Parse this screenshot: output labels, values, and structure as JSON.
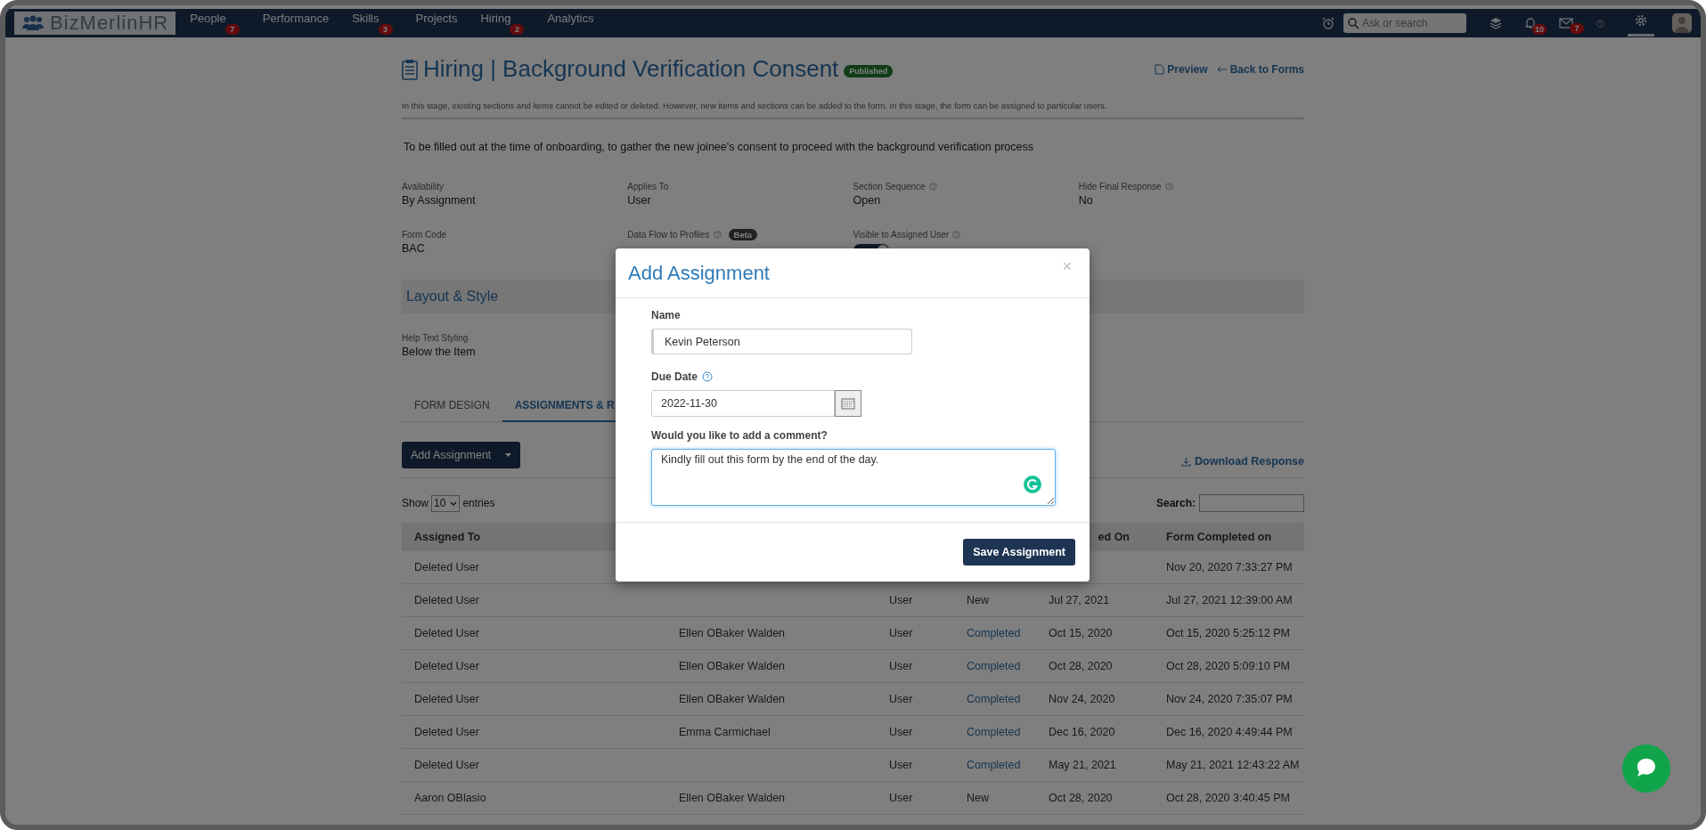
{
  "nav": {
    "logo": "BizMerlinHR",
    "items": [
      {
        "label": "People",
        "badge": "7"
      },
      {
        "label": "Performance"
      },
      {
        "label": "Skills",
        "badge": "3"
      },
      {
        "label": "Projects"
      },
      {
        "label": "Hiring",
        "badge": "2"
      },
      {
        "label": "Analytics"
      }
    ],
    "search": {
      "placeholder": "Ask or search"
    },
    "notifications_badge": "10",
    "messages_badge": "7"
  },
  "page": {
    "title": "Hiring | Background Verification Consent",
    "status": "Published",
    "links": [
      "Preview",
      "Back to Forms"
    ],
    "stage_note": "In this stage, existing sections and items cannot be edited or deleted. However, new items and sections can be added to the form. In this stage, the form can be assigned to particular users.",
    "description": "To be filled out at the time of onboarding, to gather the new joinee's consent to proceed with the background verification process",
    "details": [
      {
        "kind": "text",
        "label": "Availability",
        "value": "By Assignment",
        "help": false
      },
      {
        "kind": "text",
        "label": "Applies To",
        "value": "User",
        "help": false
      },
      {
        "kind": "text",
        "label": "Section Sequence",
        "value": "Open",
        "help": true
      },
      {
        "kind": "text",
        "label": "Hide Final Response",
        "value": "No",
        "help": true
      },
      {
        "kind": "text",
        "label": "Form Code",
        "value": "BAC",
        "help": false
      },
      {
        "kind": "text",
        "label": "Data Flow to Profiles",
        "badge": "Beta",
        "help": true
      },
      {
        "kind": "toggle",
        "label": "Visible to Assigned User",
        "on": true,
        "help": true
      }
    ],
    "section_title": "Layout & Style",
    "style_details": [
      {
        "label": "Help Text Styling",
        "value": "Below the Item"
      }
    ]
  },
  "tabs": [
    {
      "label": "FORM DESIGN",
      "selected": false
    },
    {
      "label": "ASSIGNMENTS & R",
      "selected": true
    }
  ],
  "add_button": "Add Assignment",
  "download_link": "Download Response",
  "show_entries": {
    "show": "Show",
    "value": "10",
    "entries": "entries"
  },
  "search_label": "Search:",
  "table": {
    "columns": [
      "Assigned To",
      null,
      null,
      null,
      "ed On",
      "Form Completed on"
    ],
    "rows": [
      {
        "cells": [
          "Deleted User",
          null,
          null,
          null,
          null,
          "Nov 20, 2020 7:33:27 PM"
        ]
      },
      {
        "completed": false,
        "cells": [
          "Deleted User",
          null,
          "User",
          "New",
          "Jul 27, 2021",
          "Jul 27, 2021 12:39:00 AM"
        ]
      },
      {
        "completed": true,
        "cells": [
          "Deleted User",
          "Ellen OBaker Walden",
          "User",
          "Completed",
          "Oct 15, 2020",
          "Oct 15, 2020 5:25:12 PM"
        ]
      },
      {
        "completed": true,
        "cells": [
          "Deleted User",
          "Ellen OBaker Walden",
          "User",
          "Completed",
          "Oct 28, 2020",
          "Oct 28, 2020 5:09:10 PM"
        ]
      },
      {
        "completed": true,
        "cells": [
          "Deleted User",
          "Ellen OBaker Walden",
          "User",
          "Completed",
          "Nov 24, 2020",
          "Nov 24, 2020 7:35:07 PM"
        ]
      },
      {
        "completed": true,
        "cells": [
          "Deleted User",
          "Emma Carmichael",
          "User",
          "Completed",
          "Dec 16, 2020",
          "Dec 16, 2020 4:49:44 PM"
        ]
      },
      {
        "completed": true,
        "cells": [
          "Deleted User",
          null,
          "User",
          "Completed",
          "May 21, 2021",
          "May 21, 2021 12:43:22 AM"
        ]
      },
      {
        "completed": false,
        "cells": [
          "Aaron OBlasio",
          "Ellen OBaker Walden",
          "User",
          "New",
          "Oct 28, 2020",
          "Oct 28, 2020 3:40:45 PM"
        ]
      }
    ]
  },
  "modal": {
    "title": "Add Assignment",
    "close": "×",
    "name": {
      "label": "Name",
      "value": "Kevin Peterson"
    },
    "due_date": {
      "label": "Due Date",
      "value": "2022-11-30"
    },
    "comment": {
      "label": "Would you like to add a comment?",
      "value": "Kindly fill out this form by the end of the day."
    },
    "save_button": "Save Assignment"
  }
}
